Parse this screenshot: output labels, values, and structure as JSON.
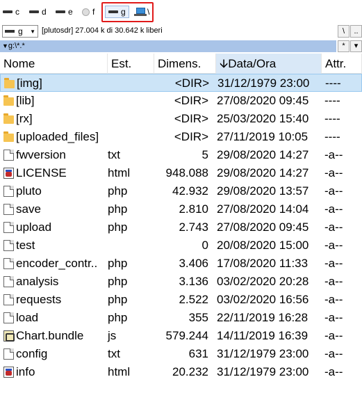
{
  "drives": [
    {
      "letter": "c",
      "icon": "drive-icon"
    },
    {
      "letter": "d",
      "icon": "drive-icon"
    },
    {
      "letter": "e",
      "icon": "drive-icon"
    },
    {
      "letter": "f",
      "icon": "cd-drive-icon"
    },
    {
      "letter": "g",
      "icon": "drive-icon",
      "active": true
    },
    {
      "letter": "\\",
      "icon": "network-drive-icon"
    }
  ],
  "pathbar": {
    "drive_select": "g",
    "free_space": "[plutosdr]  27.004 k di 30.642 k liberi",
    "root_btn": "\\",
    "up_btn": ".."
  },
  "current_path": {
    "text": "g:\\*.*",
    "star_btn": "*",
    "sort_btn": "▾"
  },
  "headers": {
    "name": "Nome",
    "ext": "Est.",
    "size": "Dimens.",
    "date": "Data/Ora",
    "attr": "Attr.",
    "sort_indicator": "🡫"
  },
  "files": [
    {
      "name": "[img]",
      "ext": "",
      "size": "<DIR>",
      "date": "31/12/1979 23:00",
      "attr": "----",
      "type": "folder",
      "selected": true
    },
    {
      "name": "[lib]",
      "ext": "",
      "size": "<DIR>",
      "date": "27/08/2020 09:45",
      "attr": "----",
      "type": "folder"
    },
    {
      "name": "[rx]",
      "ext": "",
      "size": "<DIR>",
      "date": "25/03/2020 15:40",
      "attr": "----",
      "type": "folder"
    },
    {
      "name": "[uploaded_files]",
      "ext": "",
      "size": "<DIR>",
      "date": "27/11/2019 10:05",
      "attr": "----",
      "type": "folder"
    },
    {
      "name": "fwversion",
      "ext": "txt",
      "size": "5",
      "date": "29/08/2020 14:27",
      "attr": "-a--",
      "type": "text"
    },
    {
      "name": "LICENSE",
      "ext": "html",
      "size": "948.088",
      "date": "29/08/2020 14:27",
      "attr": "-a--",
      "type": "html"
    },
    {
      "name": "pluto",
      "ext": "php",
      "size": "42.932",
      "date": "29/08/2020 13:57",
      "attr": "-a--",
      "type": "doc"
    },
    {
      "name": "save",
      "ext": "php",
      "size": "2.810",
      "date": "27/08/2020 14:04",
      "attr": "-a--",
      "type": "doc"
    },
    {
      "name": "upload",
      "ext": "php",
      "size": "2.743",
      "date": "27/08/2020 09:45",
      "attr": "-a--",
      "type": "doc"
    },
    {
      "name": "test",
      "ext": "",
      "size": "0",
      "date": "20/08/2020 15:00",
      "attr": "-a--",
      "type": "doc"
    },
    {
      "name": "encoder_contr..",
      "ext": "php",
      "size": "3.406",
      "date": "17/08/2020 11:33",
      "attr": "-a--",
      "type": "doc"
    },
    {
      "name": "analysis",
      "ext": "php",
      "size": "3.136",
      "date": "03/02/2020 20:28",
      "attr": "-a--",
      "type": "doc"
    },
    {
      "name": "requests",
      "ext": "php",
      "size": "2.522",
      "date": "03/02/2020 16:56",
      "attr": "-a--",
      "type": "doc"
    },
    {
      "name": "load",
      "ext": "php",
      "size": "355",
      "date": "22/11/2019 16:28",
      "attr": "-a--",
      "type": "doc"
    },
    {
      "name": "Chart.bundle",
      "ext": "js",
      "size": "579.244",
      "date": "14/11/2019 16:39",
      "attr": "-a--",
      "type": "js"
    },
    {
      "name": "config",
      "ext": "txt",
      "size": "631",
      "date": "31/12/1979 23:00",
      "attr": "-a--",
      "type": "text"
    },
    {
      "name": "info",
      "ext": "html",
      "size": "20.232",
      "date": "31/12/1979 23:00",
      "attr": "-a--",
      "type": "html"
    }
  ]
}
